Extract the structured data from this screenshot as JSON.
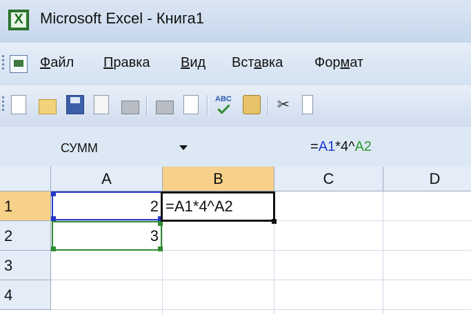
{
  "window": {
    "app_icon": "excel-icon",
    "app_icon_glyph": "X",
    "title": "Microsoft Excel - Книга1"
  },
  "menu": {
    "icon": "workbook-menu-icon",
    "items": [
      {
        "mnemonic": "Ф",
        "rest": "айл"
      },
      {
        "mnemonic": "П",
        "rest": "равка"
      },
      {
        "mnemonic": "В",
        "rest": "ид"
      },
      {
        "before": "Вст",
        "mnemonic": "а",
        "rest": "вка"
      },
      {
        "before": "Фор",
        "mnemonic": "м",
        "rest": "ат"
      }
    ]
  },
  "toolbar": {
    "icons": [
      "new-icon",
      "open-icon",
      "save-icon",
      "permission-icon",
      "print-icon",
      "print-preview-icon",
      "spelling-icon",
      "research-icon",
      "cut-icon",
      "copy-icon"
    ],
    "spelling_glyph": "ABC",
    "cut_glyph": "✂"
  },
  "formula_bar": {
    "name_box": "СУММ",
    "formula_prefix": "=",
    "formula_ref1": "A1",
    "formula_mid": "*4^",
    "formula_ref2": "A2"
  },
  "sheet": {
    "columns": [
      "A",
      "B",
      "C",
      "D"
    ],
    "rows": [
      "1",
      "2",
      "3",
      "4"
    ],
    "cells": {
      "A1": "2",
      "B1": "=A1*4^A2",
      "A2": "3"
    },
    "active_cell": "B1",
    "colors": {
      "ref1": "#2338c8",
      "ref2": "#2e8b2e",
      "header_selected": "#f7d08a"
    }
  }
}
